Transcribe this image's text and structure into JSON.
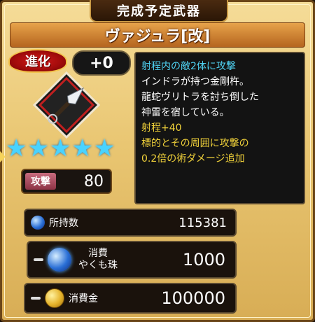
{
  "header": {
    "tab_title": "完成予定武器",
    "weapon_name": "ヴァジュラ[改]"
  },
  "evolution": {
    "label": "進化",
    "plus_value": "+0"
  },
  "weapon": {
    "icon": "kunai-icon",
    "stars": 5,
    "stars_text": [
      "★",
      "★",
      "★",
      "★",
      "★"
    ]
  },
  "attack": {
    "label": "攻撃",
    "value": "80"
  },
  "description": {
    "line1": "射程内の敵2体に攻撃",
    "line2": "インドラが持つ金剛杵。",
    "line3": "龍蛇ヴリトラを討ち倒した",
    "line4": "神雷を宿している。",
    "line5": "射程+40",
    "line6": "標的とその周囲に攻撃の",
    "line7": "0.2倍の術ダメージ追加"
  },
  "resources": {
    "owned_label": "所持数",
    "owned_value": "115381",
    "consume_item_label_1": "消費",
    "consume_item_label_2": "やくも珠",
    "consume_item_value": "1000",
    "consume_gold_label": "消費金",
    "consume_gold_value": "100000"
  },
  "colors": {
    "accent_cyan": "#4fd0f0",
    "accent_yellow": "#f1d23a",
    "star": "#49d3ff"
  }
}
